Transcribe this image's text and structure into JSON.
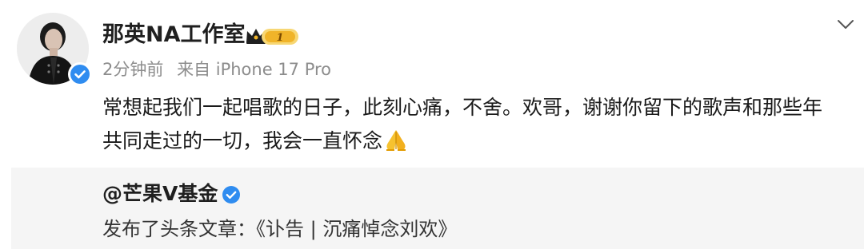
{
  "post": {
    "author": "那英NA工作室",
    "vip_level": "1",
    "time": "2分钟前",
    "source": "来自 iPhone 17 Pro",
    "content_lines": [
      "常想起我们一起唱歌的日子，此刻心痛，不舍。欢哥，谢谢你留下的歌声和那些年",
      "共同走过的一切，我会一直怀念"
    ],
    "emoji": "folded-hands",
    "icons": {
      "verified": "verified-check-icon",
      "vip": "crown-vip-icon",
      "menu": "chevron-down-icon"
    },
    "colors": {
      "verified_blue": "#2f8cf0",
      "vip_gold": "#f0b429",
      "text_primary": "#1a1a1a",
      "text_meta": "#8c8c8c",
      "repost_bg": "#f5f5f5"
    }
  },
  "repost": {
    "author": "@芒果V基金",
    "text": "发布了头条文章：《讣告 | 沉痛悼念刘欢》"
  }
}
